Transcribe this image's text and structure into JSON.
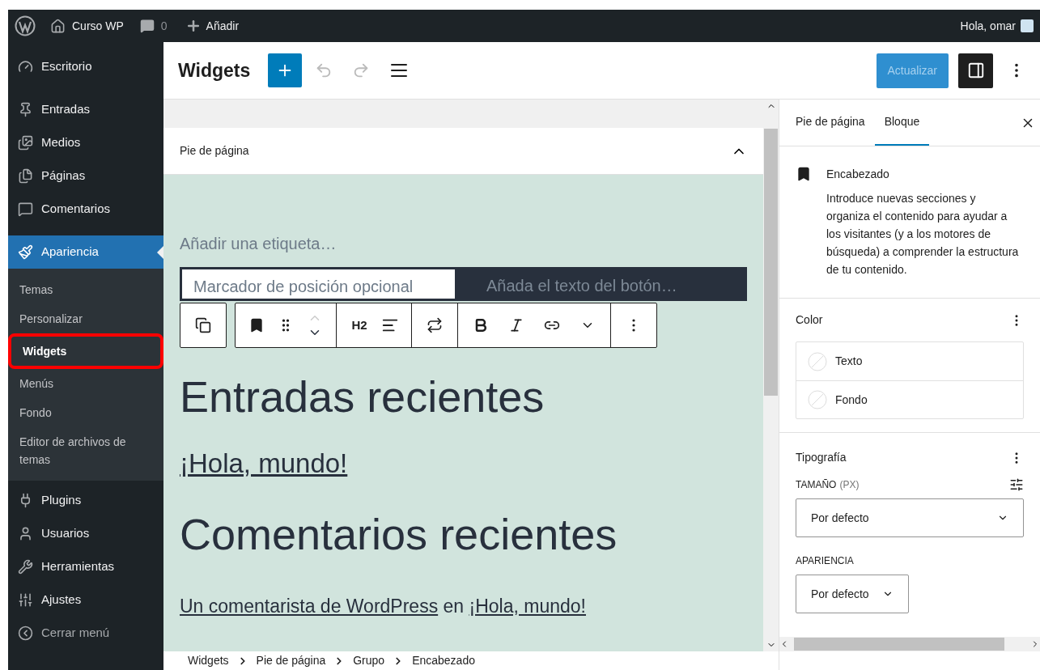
{
  "admin_bar": {
    "site": "Curso WP",
    "comments": "0",
    "new": "Añadir",
    "greeting": "Hola, omar"
  },
  "sidebar": {
    "items": [
      {
        "label": "Escritorio",
        "selected": false
      },
      {
        "label": "Entradas",
        "selected": false
      },
      {
        "label": "Medios",
        "selected": false
      },
      {
        "label": "Páginas",
        "selected": false
      },
      {
        "label": "Comentarios",
        "selected": false
      },
      {
        "label": "Apariencia",
        "selected": true,
        "children": [
          {
            "label": "Temas",
            "selected": false,
            "highlighted": false
          },
          {
            "label": "Personalizar",
            "selected": false,
            "highlighted": false
          },
          {
            "label": "Widgets",
            "selected": true,
            "highlighted": true
          },
          {
            "label": "Menús",
            "selected": false,
            "highlighted": false
          },
          {
            "label": "Fondo",
            "selected": false,
            "highlighted": false
          },
          {
            "label": "Editor de archivos de temas",
            "selected": false,
            "highlighted": false
          }
        ]
      },
      {
        "label": "Plugins",
        "selected": false
      },
      {
        "label": "Usuarios",
        "selected": false
      },
      {
        "label": "Herramientas",
        "selected": false
      },
      {
        "label": "Ajustes",
        "selected": false
      },
      {
        "label": "Cerrar menú",
        "selected": false
      }
    ]
  },
  "header": {
    "title": "Widgets",
    "undo_disabled": true,
    "redo_disabled": true,
    "update_button": {
      "label": "Actualizar",
      "disabled": true
    }
  },
  "widget_area": {
    "title": "Pie de página",
    "expanded": true,
    "search": {
      "label_placeholder": "Añadir una etiqueta…",
      "input_placeholder": "Marcador de posición opcional",
      "button_placeholder": "Añada el texto del botón…"
    },
    "toolbar": {
      "heading_level": "H2"
    },
    "heading_1": "Entradas recientes",
    "post_link": "¡Hola, mundo!",
    "heading_2": "Comentarios recientes",
    "comment": {
      "author": "Un comentarista de WordPress",
      "joiner": "en",
      "post": "¡Hola, mundo!"
    }
  },
  "breadcrumb": [
    "Widgets",
    "Pie de página",
    "Grupo",
    "Encabezado"
  ],
  "inspector": {
    "tabs": [
      {
        "label": "Pie de página",
        "selected": false
      },
      {
        "label": "Bloque",
        "selected": true
      }
    ],
    "block": {
      "name": "Encabezado",
      "description": "Introduce nuevas secciones y organiza el contenido para ayudar a los visitantes (y a los motores de búsqueda) a comprender la estructura de tu contenido."
    },
    "color": {
      "title": "Color",
      "items": [
        "Texto",
        "Fondo"
      ]
    },
    "typography": {
      "title": "Tipografía",
      "size_label": "TAMAÑO",
      "size_unit": "(PX)",
      "size_value": "Por defecto",
      "appearance_label": "APARIENCIA",
      "appearance_value": "Por defecto"
    }
  }
}
